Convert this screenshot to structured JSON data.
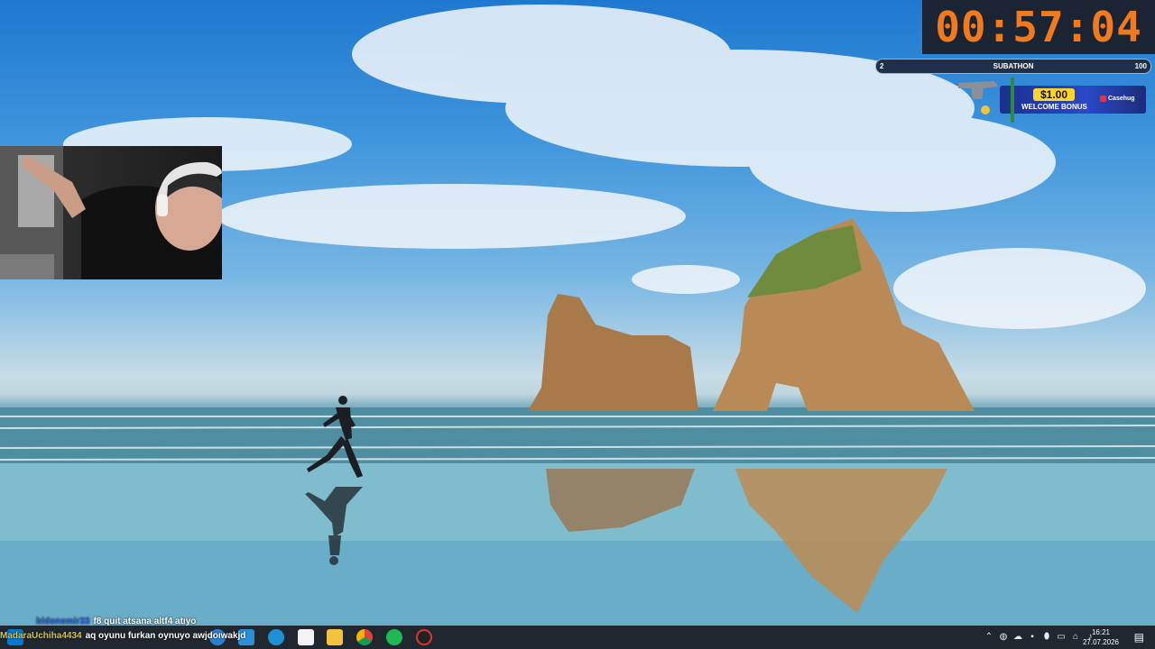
{
  "overlay": {
    "timer": "00:57:04",
    "subathon": {
      "min": "2",
      "label": "SUBATHON",
      "max": "100"
    },
    "promo": {
      "amount": "$1.00",
      "bonus": "WELCOME BONUS",
      "brand": "Casehug"
    }
  },
  "chat": {
    "messages": [
      {
        "user": "bldonemir33",
        "text": "f8 quit atsana altf4 atıyo"
      },
      {
        "user": "MadaraUchiha4434",
        "text": "aq oyunu furkan oynuyo awjdoıwakjd"
      }
    ]
  },
  "taskbar": {
    "pinned": [
      "start-icon",
      "search-icon",
      "task-view-icon",
      "edge-icon",
      "store-icon",
      "file-explorer-icon",
      "chrome-icon",
      "spotify-icon",
      "obs-icon"
    ],
    "clock": {
      "time": "16:21",
      "date": "27.07.2026"
    }
  }
}
